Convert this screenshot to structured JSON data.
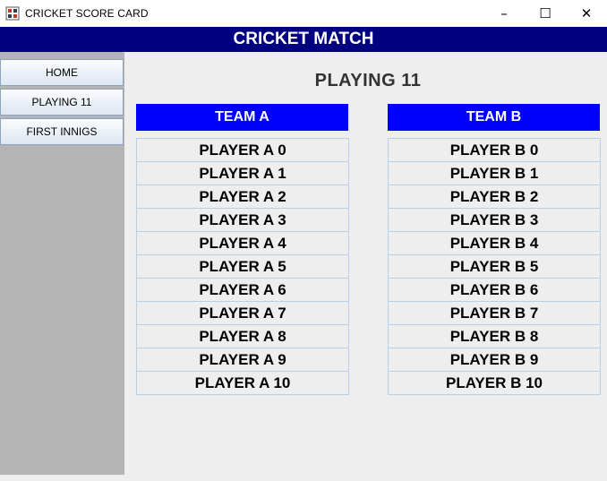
{
  "window": {
    "title": "CRICKET SCORE CARD",
    "icon": "app-icon",
    "controls": {
      "minimize": "–",
      "maximize": "☐",
      "close": "✕"
    }
  },
  "header": {
    "title": "CRICKET MATCH"
  },
  "sidebar": {
    "items": [
      {
        "label": "HOME"
      },
      {
        "label": "PLAYING 11"
      },
      {
        "label": "FIRST INNIGS"
      }
    ]
  },
  "main": {
    "title": "PLAYING  11",
    "team_a": {
      "label": "TEAM A",
      "players": [
        "PLAYER A 0",
        "PLAYER A 1",
        "PLAYER A 2",
        "PLAYER A 3",
        "PLAYER A 4",
        "PLAYER A 5",
        "PLAYER A 6",
        "PLAYER A 7",
        "PLAYER A 8",
        "PLAYER A 9",
        "PLAYER A 10"
      ]
    },
    "team_b": {
      "label": "TEAM B",
      "players": [
        "PLAYER B 0",
        "PLAYER B 1",
        "PLAYER B 2",
        "PLAYER B 3",
        "PLAYER B 4",
        "PLAYER B 5",
        "PLAYER B 6",
        "PLAYER B 7",
        "PLAYER B 8",
        "PLAYER B 9",
        "PLAYER B 10"
      ]
    }
  },
  "colors": {
    "header_bg": "#000080",
    "team_header_bg": "#0000ff",
    "sidebar_bg": "#b4b4b4",
    "content_bg": "#eeeeee"
  }
}
